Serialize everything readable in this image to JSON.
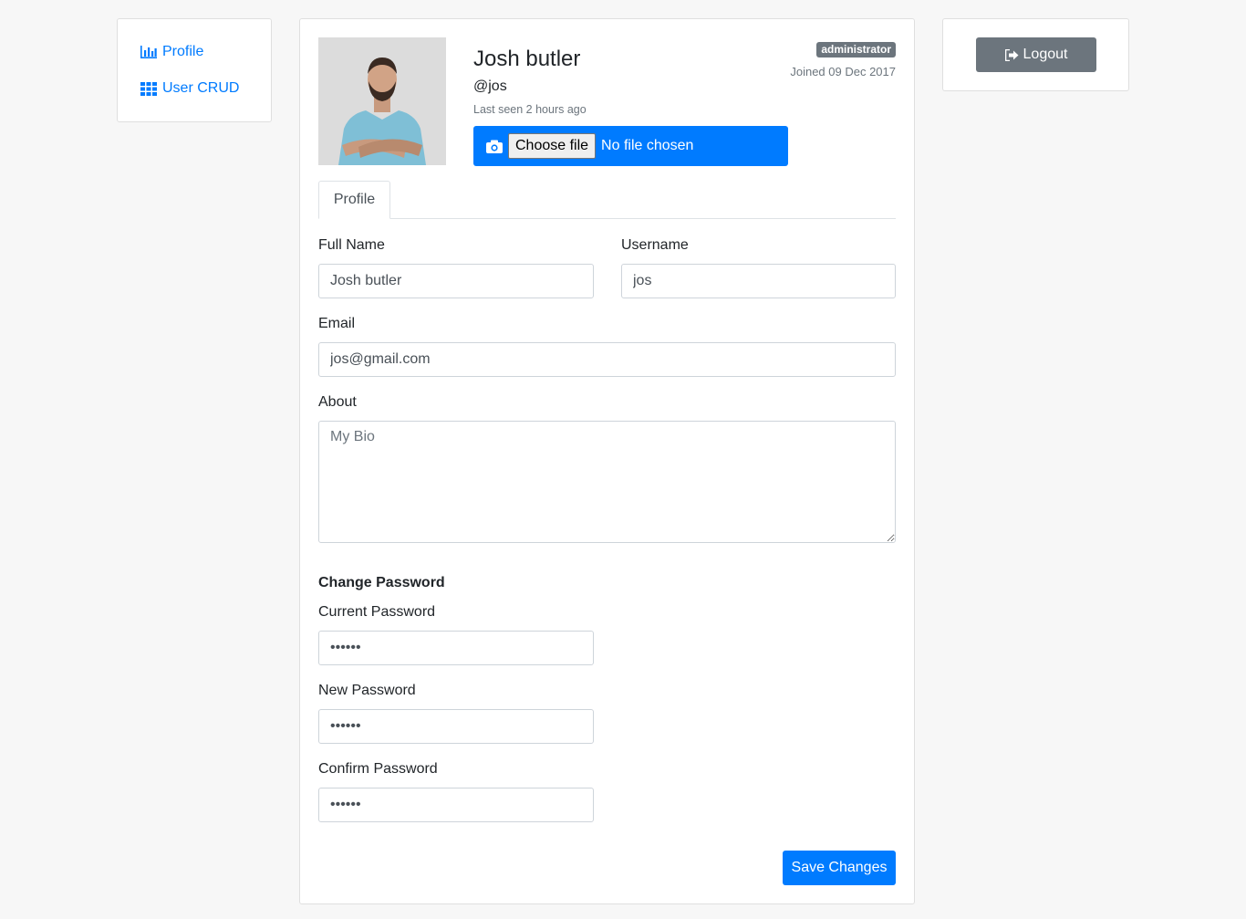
{
  "nav": {
    "items": [
      {
        "label": "Profile",
        "icon": "bar-chart-icon"
      },
      {
        "label": "User CRUD",
        "icon": "grid-icon"
      }
    ]
  },
  "profile": {
    "name": "Josh butler",
    "handle": "@jos",
    "last_seen": "Last seen 2 hours ago",
    "role_badge": "administrator",
    "joined": "Joined 09 Dec 2017",
    "file_picker": {
      "choose_label": "Choose file",
      "status": "No file chosen",
      "icon": "camera-icon"
    }
  },
  "tabs": [
    {
      "label": "Profile"
    }
  ],
  "form": {
    "full_name": {
      "label": "Full Name",
      "value": "Josh butler"
    },
    "username": {
      "label": "Username",
      "value": "jos"
    },
    "email": {
      "label": "Email",
      "value": "jos@gmail.com"
    },
    "about": {
      "label": "About",
      "placeholder": "My Bio",
      "value": ""
    },
    "change_password_title": "Change Password",
    "current_password": {
      "label": "Current Password",
      "value": "••••••"
    },
    "new_password": {
      "label": "New Password",
      "value": "••••••"
    },
    "confirm_password": {
      "label": "Confirm Password",
      "value": "••••••"
    },
    "save_label": "Save Changes"
  },
  "logout": {
    "label": "Logout",
    "icon": "sign-out-icon"
  },
  "colors": {
    "primary": "#007bff",
    "secondary": "#6c757d",
    "background": "#f7f7f7"
  }
}
